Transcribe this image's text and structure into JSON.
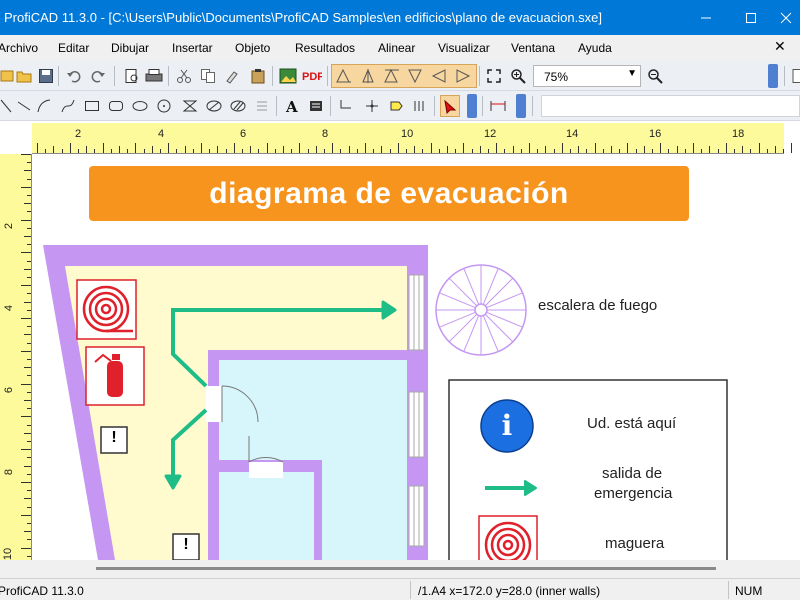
{
  "window": {
    "title": "ProfiCAD 11.3.0 - [C:\\Users\\Public\\Documents\\ProfiCAD Samples\\en edificios\\plano de evacuacion.sxe]",
    "minimize": "—",
    "maximize": "☐",
    "close": "✕"
  },
  "menu": {
    "items": [
      "Archivo",
      "Editar",
      "Dibujar",
      "Insertar",
      "Objeto",
      "Resultados",
      "Alinear",
      "Visualizar",
      "Ventana",
      "Ayuda"
    ],
    "close_doc": "✕"
  },
  "toolbar": {
    "zoom_value": "75%",
    "zoom_options": [
      "75%"
    ]
  },
  "rulers": {
    "horizontal_labels": [
      "2",
      "4",
      "6",
      "8",
      "10",
      "12",
      "14",
      "16",
      "18"
    ],
    "vertical_labels": [
      "2",
      "4",
      "6",
      "8",
      "10"
    ]
  },
  "drawing": {
    "banner_title": "diagrama de evacuación",
    "fire_stairs_label": "escalera de fuego",
    "legend": {
      "you_are_here": "Ud. está aquí",
      "info_symbol": "i",
      "emergency_exit_line1": "salida de",
      "emergency_exit_line2": "emergencia",
      "hose": "maguera"
    },
    "exclamation": "!"
  },
  "status": {
    "app": "ProfiCAD 11.3.0",
    "coords": "/1.A4  x=172.0  y=28.0 (inner walls)",
    "num": "NUM"
  },
  "colors": {
    "titlebar": "#0078d7",
    "banner": "#f7941d",
    "wall": "#c597f2",
    "floor": "#fffbcf",
    "room": "#d6f6fb",
    "arrow": "#1ebc86",
    "hose_red": "#e0202a",
    "info_blue": "#1b6fe0"
  }
}
